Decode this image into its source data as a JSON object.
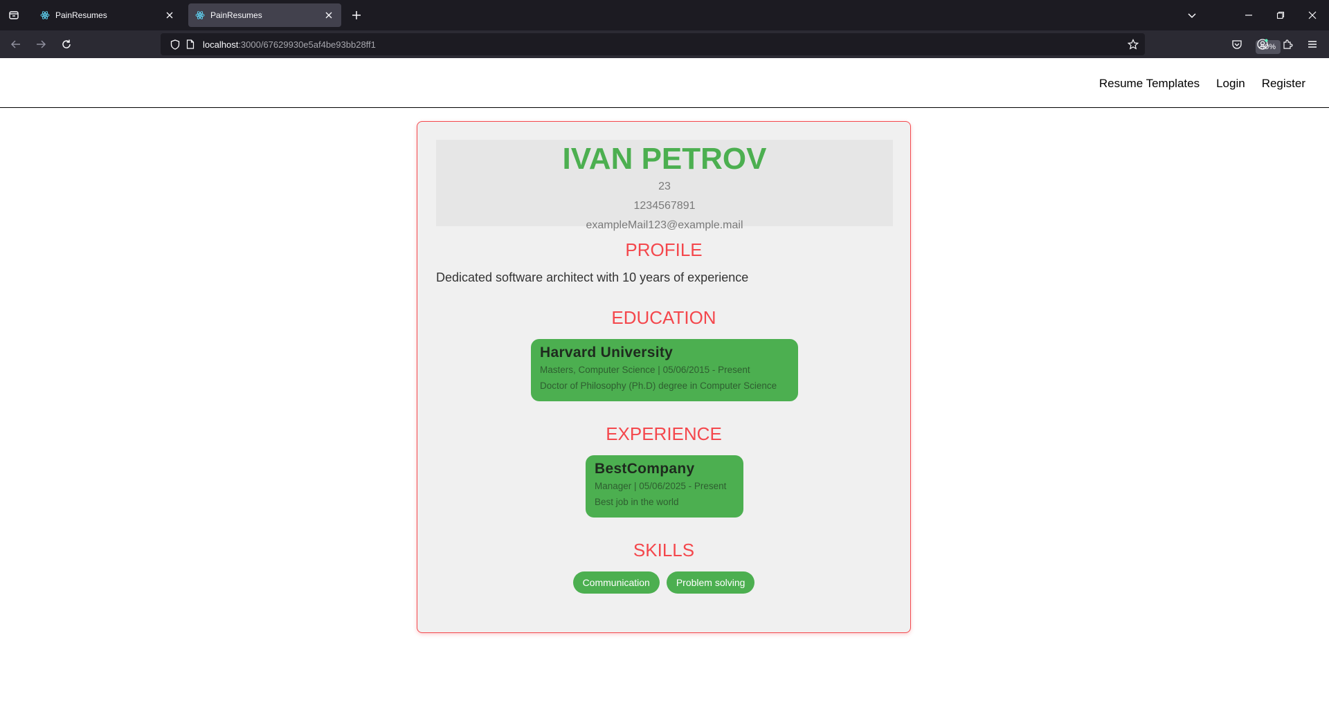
{
  "browser": {
    "tabs": [
      {
        "title": "PainResumes",
        "active": false
      },
      {
        "title": "PainResumes",
        "active": true
      }
    ],
    "url_host": "localhost",
    "url_path": ":3000/67629930e5af4be93bb28ff1",
    "zoom": "90%"
  },
  "header": {
    "nav": [
      "Resume Templates",
      "Login",
      "Register"
    ]
  },
  "resume": {
    "name": "IVAN PETROV",
    "age": "23",
    "phone": "1234567891",
    "email": "exampleMail123@example.mail",
    "sections": {
      "profile": "PROFILE",
      "education": "EDUCATION",
      "experience": "EXPERIENCE",
      "skills": "SKILLS"
    },
    "profile": "Dedicated software architect with 10 years of experience",
    "education": {
      "school": "Harvard University",
      "details": "Masters, Computer Science | 05/06/2015 - Present",
      "description": "Doctor of Philosophy (Ph.D) degree in Computer Science"
    },
    "experience": {
      "company": "BestCompany",
      "details": "Manager | 05/06/2025 - Present",
      "description": "Best job in the world"
    },
    "skills": [
      "Communication",
      "Problem solving"
    ]
  },
  "colors": {
    "accent_green": "#4caf50",
    "accent_red": "#f4474c"
  }
}
